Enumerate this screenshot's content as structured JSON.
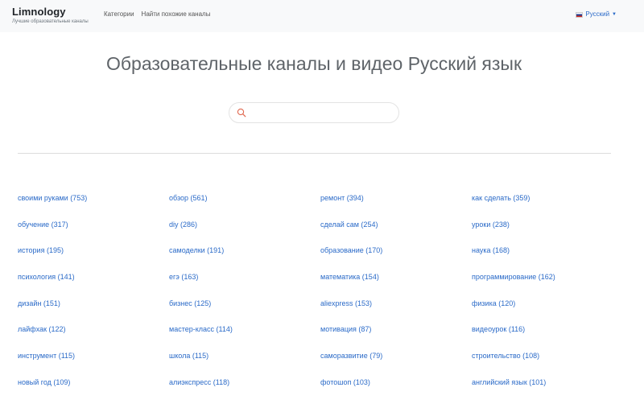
{
  "header": {
    "brand": "Limnology",
    "tagline": "Лучшие образовательные каналы",
    "nav": [
      "Категории",
      "Найти похожие каналы"
    ],
    "language": "Русский",
    "caret_icon": "caret-down-icon",
    "flag_icon": "russia-flag-icon"
  },
  "main": {
    "title": "Образовательные каналы и видео Русский язык",
    "search": {
      "placeholder": "",
      "value": "",
      "icon": "search-icon",
      "icon_color": "#e0684f"
    }
  },
  "tags": [
    "своими руками (753)",
    "обзор (561)",
    "ремонт (394)",
    "как сделать (359)",
    "обучение (317)",
    "diy (286)",
    "сделай сам (254)",
    "уроки (238)",
    "история (195)",
    "самоделки (191)",
    "образование (170)",
    "наука (168)",
    "психология (141)",
    "егэ (163)",
    "математика (154)",
    "программирование (162)",
    "дизайн (151)",
    "бизнес (125)",
    "aliexpress (153)",
    "физика (120)",
    "лайфхак (122)",
    "мастер-класс (114)",
    "мотивация (87)",
    "видеоурок (116)",
    "инструмент (115)",
    "школа (115)",
    "саморазвитие (79)",
    "строительство (108)",
    "новый год (109)",
    "алиэкспресс (118)",
    "фотошоп (103)",
    "английский язык (101)"
  ],
  "colors": {
    "link": "#2a6ac8",
    "navbar_bg": "#f8f9fa",
    "title": "#5f6469"
  }
}
